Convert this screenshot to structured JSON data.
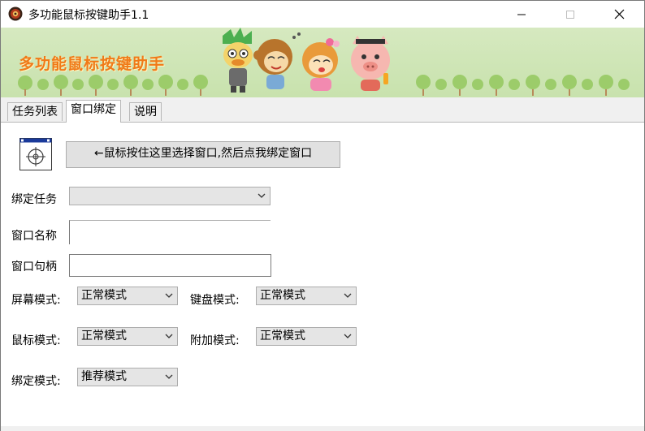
{
  "window": {
    "title": "多功能鼠标按键助手1.1"
  },
  "banner": {
    "title": "多功能鼠标按键助手"
  },
  "tabs": [
    {
      "label": "任务列表",
      "active": false
    },
    {
      "label": "窗口绑定",
      "active": true
    },
    {
      "label": "说明",
      "active": false
    }
  ],
  "bind_panel": {
    "pick_button_label": "←鼠标按住这里选择窗口,然后点我绑定窗口",
    "bind_task_label": "绑定任务",
    "bind_task_value": "",
    "window_name_label": "窗口名称",
    "window_name_value": "",
    "window_handle_label": "窗口句柄",
    "window_handle_value": "",
    "screen_mode_label": "屏幕模式:",
    "screen_mode_value": "正常模式",
    "keyboard_mode_label": "键盘模式:",
    "keyboard_mode_value": "正常模式",
    "mouse_mode_label": "鼠标模式:",
    "mouse_mode_value": "正常模式",
    "extra_mode_label": "附加模式:",
    "extra_mode_value": "正常模式",
    "bind_mode_label": "绑定模式:",
    "bind_mode_value": "推荐模式"
  },
  "colors": {
    "banner_title": "#f07a18",
    "banner_bg": "#d6e9c0",
    "tree_green": "#9ccc6a"
  }
}
